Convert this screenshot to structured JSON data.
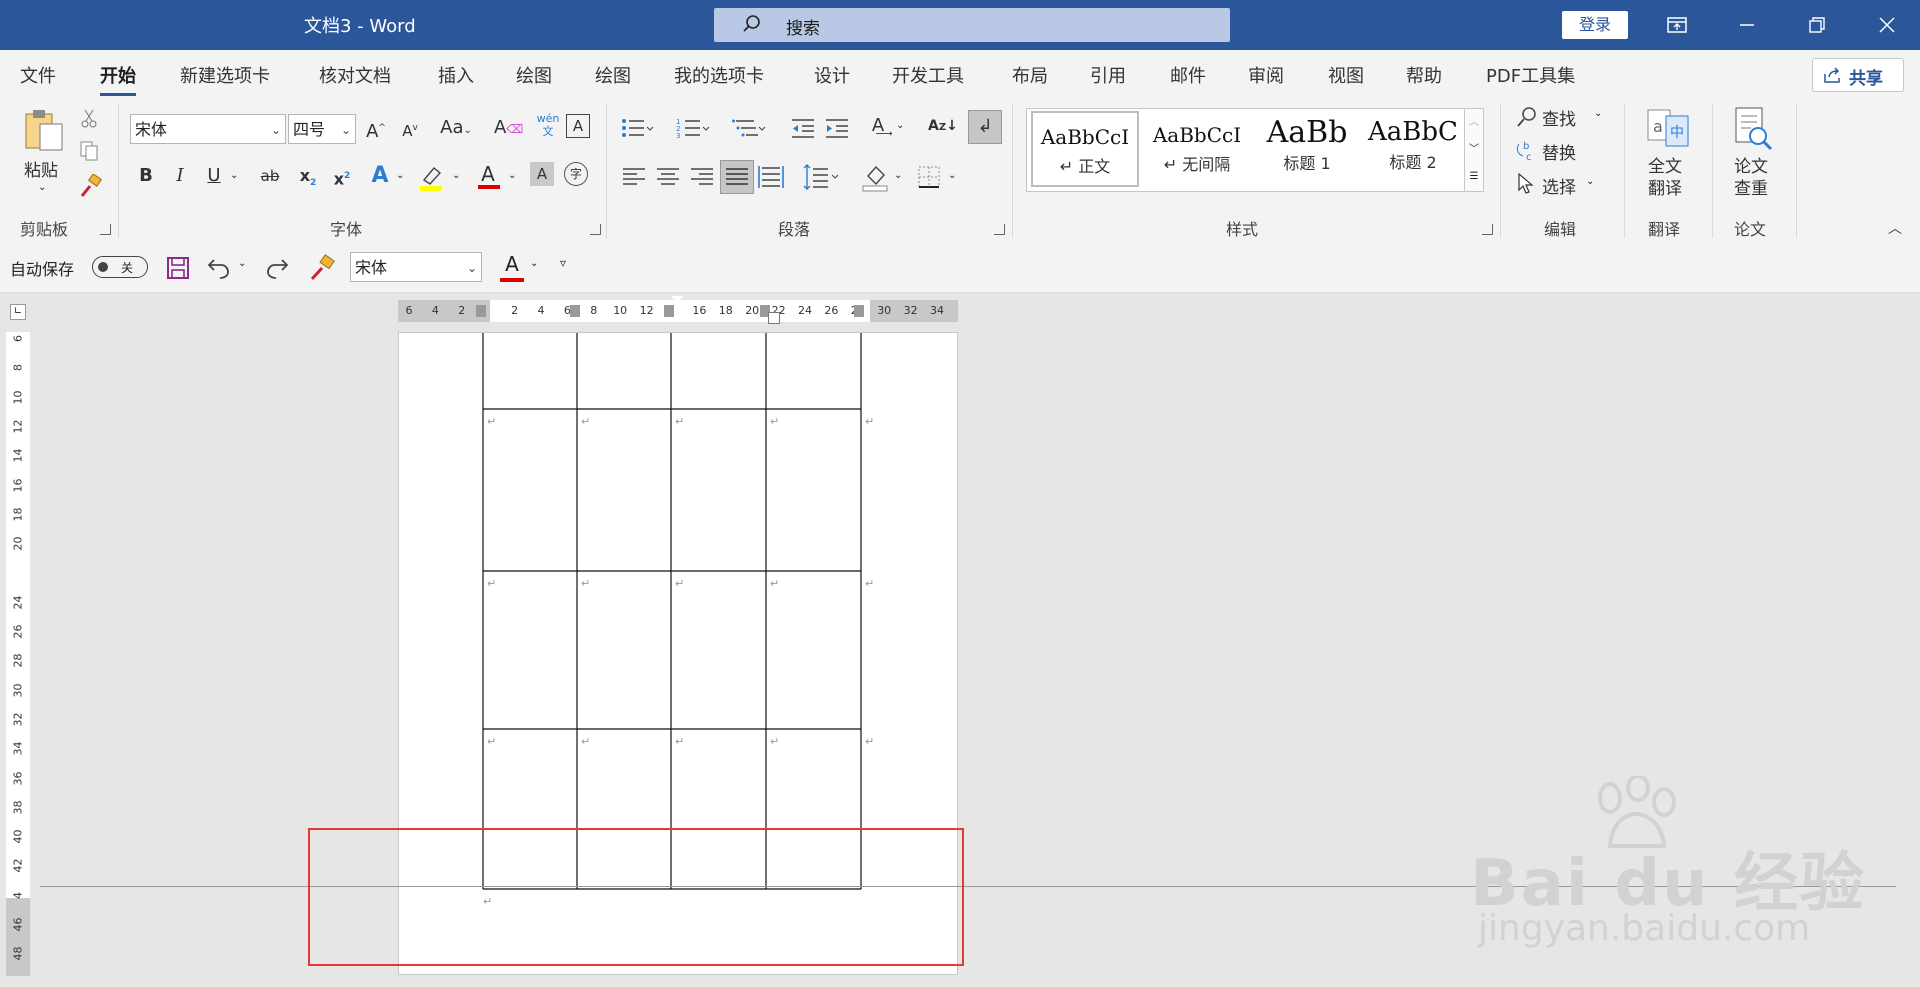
{
  "titlebar": {
    "title": "文档3  -  Word",
    "search_placeholder": "搜索",
    "login": "登录"
  },
  "tabs": [
    {
      "label": "文件"
    },
    {
      "label": "开始"
    },
    {
      "label": "新建选项卡"
    },
    {
      "label": "核对文档"
    },
    {
      "label": "插入"
    },
    {
      "label": "绘图"
    },
    {
      "label": "绘图"
    },
    {
      "label": "我的选项卡"
    },
    {
      "label": "设计"
    },
    {
      "label": "开发工具"
    },
    {
      "label": "布局"
    },
    {
      "label": "引用"
    },
    {
      "label": "邮件"
    },
    {
      "label": "审阅"
    },
    {
      "label": "视图"
    },
    {
      "label": "帮助"
    },
    {
      "label": "PDF工具集"
    }
  ],
  "share": "共享",
  "clipboard": {
    "paste": "粘贴",
    "group": "剪贴板"
  },
  "font": {
    "name": "宋体",
    "size": "四号",
    "group": "字体",
    "case": "Aa",
    "phonetic": "wén",
    "phonetic2": "文"
  },
  "paragraph": {
    "group": "段落"
  },
  "styles": {
    "group": "样式",
    "items": [
      {
        "sample": "AaBbCcI",
        "name": "↵ 正文"
      },
      {
        "sample": "AaBbCcI",
        "name": "↵ 无间隔"
      },
      {
        "sample": "AaBb",
        "name": "标题 1"
      },
      {
        "sample": "AaBbC",
        "name": "标题 2"
      }
    ]
  },
  "editing": {
    "find": "查找",
    "replace": "替换",
    "select": "选择",
    "group": "编辑"
  },
  "translate": {
    "label1": "全文",
    "label2": "翻译",
    "group": "翻译"
  },
  "paper": {
    "label1": "论文",
    "label2": "查重",
    "group": "论文"
  },
  "qat": {
    "autosave": "自动保存",
    "toggle": "关",
    "font": "宋体"
  },
  "hruler": [
    "6",
    "4",
    "2",
    "",
    "2",
    "4",
    "6",
    "8",
    "10",
    "12",
    "",
    "16",
    "18",
    "20",
    "22",
    "24",
    "26",
    "28",
    "30",
    "32",
    "34"
  ],
  "vruler": [
    "6",
    "8",
    "10",
    "12",
    "14",
    "16",
    "18",
    "20",
    "",
    "24",
    "26",
    "28",
    "30",
    "32",
    "34",
    "36",
    "38",
    "40",
    "42",
    "4",
    "46",
    "48"
  ],
  "watermark": {
    "brand": "Bai du 经验",
    "url": "jingyan.baidu.com"
  },
  "colors": {
    "title_bg": "#2b579a",
    "highlight": "#e53935",
    "font_red": "#e00000",
    "highlighter_yellow": "#ffff00"
  }
}
